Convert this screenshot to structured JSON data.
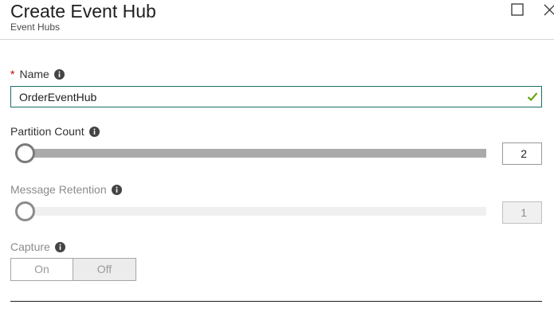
{
  "header": {
    "title": "Create Event Hub",
    "subtitle": "Event Hubs"
  },
  "form": {
    "name": {
      "required_marker": "*",
      "label": "Name",
      "value": "OrderEventHub",
      "valid": true
    },
    "partition_count": {
      "label": "Partition Count",
      "value": "2",
      "slider_level": 0.0,
      "enabled": true
    },
    "message_retention": {
      "label": "Message Retention",
      "value": "1",
      "slider_level": 0.0,
      "enabled": false
    },
    "capture": {
      "label": "Capture",
      "options": [
        "On",
        "Off"
      ],
      "selected": "Off",
      "enabled": false
    }
  },
  "icons": {
    "info": "info-icon",
    "check": "checkmark-icon",
    "maximize": "maximize-icon",
    "close": "close-icon"
  },
  "colors": {
    "input_border_focus": "#1c6e67",
    "valid_check": "#57a300",
    "required": "#c00000",
    "slider_track": "#aaaaaa",
    "slider_track_disabled": "#f0f0f0"
  }
}
